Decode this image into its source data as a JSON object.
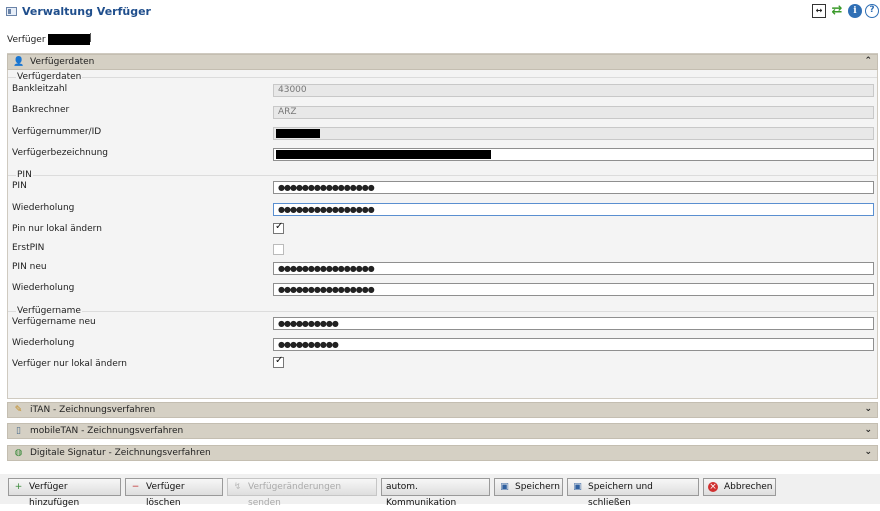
{
  "window": {
    "title": "Verwaltung Verfüger",
    "icons": [
      "window-icon",
      "expand-icon",
      "refresh-icon",
      "info-icon",
      "help-icon"
    ]
  },
  "owner": {
    "label": "Verfüger"
  },
  "panel": {
    "title": "Verfügerdaten",
    "sections": {
      "data": {
        "title": "Verfügerdaten",
        "bankleitzahl_label": "Bankleitzahl",
        "bankleitzahl_value": "43000",
        "bankrechner_label": "Bankrechner",
        "bankrechner_value": "ARZ",
        "nummer_label": "Verfügernummer/ID",
        "bezeichnung_label": "Verfügerbezeichnung"
      },
      "pin": {
        "title": "PIN",
        "pin_label": "PIN",
        "pin_value": "●●●●●●●●●●●●●●●●",
        "wiederholung_label": "Wiederholung",
        "wiederholung_value": "●●●●●●●●●●●●●●●●",
        "lokal_label": "Pin nur lokal ändern",
        "erstpin_label": "ErstPIN",
        "pin_neu_label": "PIN neu",
        "pin_neu_value": "●●●●●●●●●●●●●●●●",
        "wiederholung2_label": "Wiederholung",
        "wiederholung2_value": "●●●●●●●●●●●●●●●●"
      },
      "name": {
        "title": "Verfügername",
        "neu_label": "Verfügername neu",
        "neu_value": "●●●●●●●●●●",
        "wiederholung_label": "Wiederholung",
        "wiederholung_value": "●●●●●●●●●●",
        "lokal_label": "Verfüger nur lokal ändern"
      }
    }
  },
  "collapsed_panels": [
    {
      "title": "iTAN - Zeichnungsverfahren"
    },
    {
      "title": "mobileTAN - Zeichnungsverfahren"
    },
    {
      "title": "Digitale Signatur - Zeichnungsverfahren"
    }
  ],
  "buttons": {
    "add": "Verfüger hinzufügen",
    "delete": "Verfüger löschen",
    "send": "Verfügeränderungen senden",
    "auto": "autom. Kommunikation",
    "save": "Speichern",
    "save_close": "Speichern und schließen",
    "cancel": "Abbrechen"
  }
}
